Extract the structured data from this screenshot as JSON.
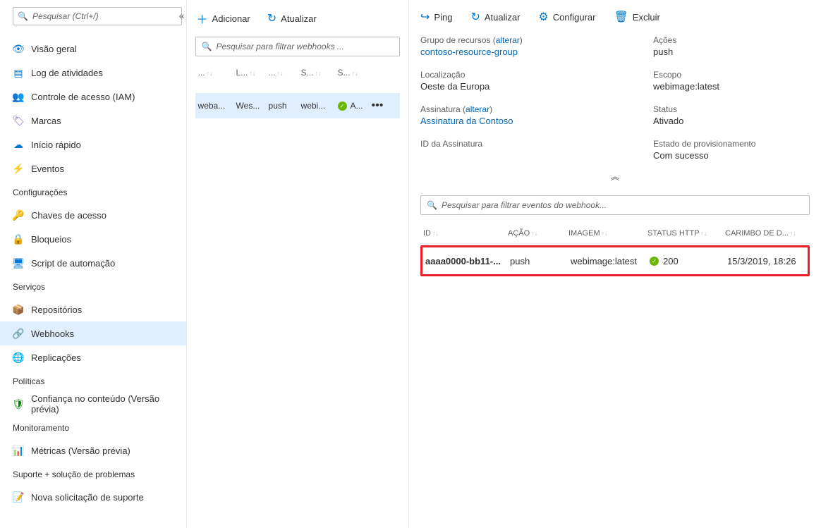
{
  "sidebar": {
    "search_placeholder": "Pesquisar (Ctrl+/)",
    "items": [
      {
        "icon": "👁",
        "label": "Visão geral",
        "cls": "c-blue"
      },
      {
        "icon": "▤",
        "label": "Log de atividades",
        "cls": "c-blue"
      },
      {
        "icon": "👥",
        "label": "Controle de acesso (IAM)",
        "cls": "c-blue"
      },
      {
        "icon": "🏷",
        "label": "Marcas",
        "cls": "c-purple"
      },
      {
        "icon": "☁",
        "label": "Início rápido",
        "cls": "c-blue"
      },
      {
        "icon": "⚡",
        "label": "Eventos",
        "cls": "c-gold"
      }
    ],
    "groups": [
      {
        "title": "Configurações",
        "items": [
          {
            "icon": "🔑",
            "label": "Chaves de acesso",
            "cls": "c-gold"
          },
          {
            "icon": "🔒",
            "label": "Bloqueios",
            "cls": "c-dark"
          },
          {
            "icon": "🖥",
            "label": "Script de automação",
            "cls": "c-blue"
          }
        ]
      },
      {
        "title": "Serviços",
        "items": [
          {
            "icon": "📦",
            "label": "Repositórios",
            "cls": "c-blue"
          },
          {
            "icon": "🔗",
            "label": "Webhooks",
            "cls": "c-green",
            "active": true
          },
          {
            "icon": "🌐",
            "label": "Replicações",
            "cls": "c-teal"
          }
        ]
      },
      {
        "title": "Políticas",
        "items": [
          {
            "icon": "🛡",
            "label": "Confiança no conteúdo (Versão prévia)",
            "cls": "c-green"
          }
        ]
      },
      {
        "title": "Monitoramento",
        "items": [
          {
            "icon": "📊",
            "label": "Métricas (Versão prévia)",
            "cls": "c-blue"
          }
        ]
      },
      {
        "title": "Suporte + solução de problemas",
        "items": [
          {
            "icon": "📝",
            "label": "Nova solicitação de suporte",
            "cls": "c-blue"
          }
        ]
      }
    ]
  },
  "middle": {
    "toolbar": {
      "add": "Adicionar",
      "refresh": "Atualizar"
    },
    "filter_placeholder": "Pesquisar para filtrar webhooks ...",
    "headers": [
      "...",
      "L...",
      "...",
      "S...",
      "S..."
    ],
    "row": {
      "c1": "weba...",
      "c2": "Wes...",
      "c3": "push",
      "c4": "webi...",
      "c5": "A..."
    }
  },
  "detail": {
    "toolbar": {
      "ping": "Ping",
      "refresh": "Atualizar",
      "configure": "Configurar",
      "delete": "Excluir"
    },
    "labels": {
      "rg": "Grupo de recursos",
      "change": "alterar",
      "rg_value": "contoso-resource-group",
      "loc": "Localização",
      "loc_value": "Oeste da Europa",
      "sub": "Assinatura",
      "sub_value": "Assinatura da Contoso",
      "sub_id": "ID da Assinatura",
      "actions": "Ações",
      "actions_value": "push",
      "scope": "Escopo",
      "scope_value": "webimage:latest",
      "status": "Status",
      "status_value": "Ativado",
      "prov": "Estado de provisionamento",
      "prov_value": "Com sucesso"
    },
    "events": {
      "filter_placeholder": "Pesquisar para filtrar eventos do webhook...",
      "headers": {
        "id": "ID",
        "action": "AÇÃO",
        "image": "IMAGEM",
        "http": "STATUS HTTP",
        "ts": "CARIMBO DE D..."
      },
      "row": {
        "id": "aaaa0000-bb11-...",
        "action": "push",
        "image": "webimage:latest",
        "http": "200",
        "ts": "15/3/2019, 18:26"
      }
    }
  }
}
